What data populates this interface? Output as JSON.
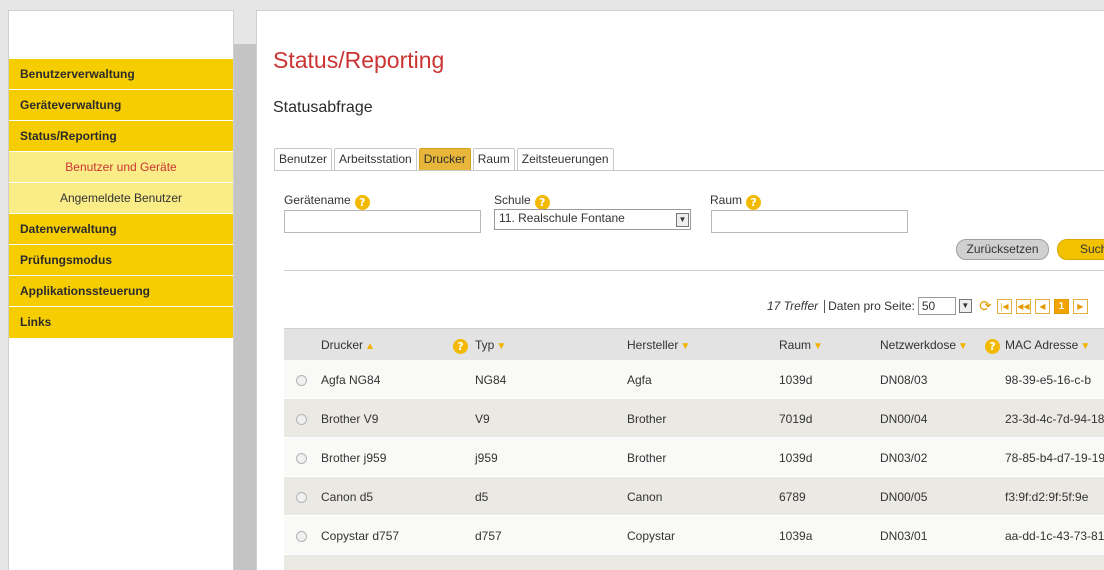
{
  "sidebar": {
    "items": [
      {
        "label": "Benutzerverwaltung",
        "level": "main"
      },
      {
        "label": "Geräteverwaltung",
        "level": "main"
      },
      {
        "label": "Status/Reporting",
        "level": "main"
      },
      {
        "label": "Benutzer und Geräte",
        "level": "sub",
        "active": true
      },
      {
        "label": "Angemeldete Benutzer",
        "level": "sub"
      },
      {
        "label": "Datenverwaltung",
        "level": "main"
      },
      {
        "label": "Prüfungsmodus",
        "level": "main"
      },
      {
        "label": "Applikationssteuerung",
        "level": "main"
      },
      {
        "label": "Links",
        "level": "main"
      }
    ]
  },
  "main": {
    "title": "Status/Reporting",
    "section_title": "Statusabfrage",
    "tabs": [
      "Benutzer",
      "Arbeitsstation",
      "Drucker",
      "Raum",
      "Zeitsteuerungen"
    ],
    "active_tab": "Drucker"
  },
  "filters": {
    "geraetename_label": "Gerätename",
    "geraetename_value": "",
    "schule_label": "Schule",
    "schule_value": "11. Realschule Fontane",
    "raum_label": "Raum",
    "raum_value": "",
    "help_glyph": "?",
    "reset_label": "Zurücksetzen",
    "search_label": "Suchen"
  },
  "pager": {
    "hits": "17 Treffer",
    "per_page_label": "Daten pro Seite:",
    "per_page_value": "50",
    "current_page": "1"
  },
  "table": {
    "headers": {
      "name": "Drucker",
      "typ": "Typ",
      "hersteller": "Hersteller",
      "raum": "Raum",
      "netzwerkdose": "Netzwerkdose",
      "mac": "MAC Adresse"
    },
    "rows": [
      {
        "name": "Agfa NG84",
        "typ": "NG84",
        "hersteller": "Agfa",
        "raum": "1039d",
        "netzwerkdose": "DN08/03",
        "mac": "98-39-e5-16-c-b"
      },
      {
        "name": "Brother V9",
        "typ": "V9",
        "hersteller": "Brother",
        "raum": "7019d",
        "netzwerkdose": "DN00/04",
        "mac": "23-3d-4c-7d-94-18"
      },
      {
        "name": "Brother j959",
        "typ": "j959",
        "hersteller": "Brother",
        "raum": "1039d",
        "netzwerkdose": "DN03/02",
        "mac": "78-85-b4-d7-19-19"
      },
      {
        "name": "Canon d5",
        "typ": "d5",
        "hersteller": "Canon",
        "raum": "6789",
        "netzwerkdose": "DN00/05",
        "mac": "f3:9f:d2:9f:5f:9e"
      },
      {
        "name": "Copystar d757",
        "typ": "d757",
        "hersteller": "Copystar",
        "raum": "1039a",
        "netzwerkdose": "DN03/01",
        "mac": "aa-dd-1c-43-73-81"
      }
    ]
  },
  "colors": {
    "nav_main": "#f6cd00",
    "nav_sub": "#faed88",
    "title_red": "#cc3333",
    "accent_orange": "#f2a300"
  }
}
